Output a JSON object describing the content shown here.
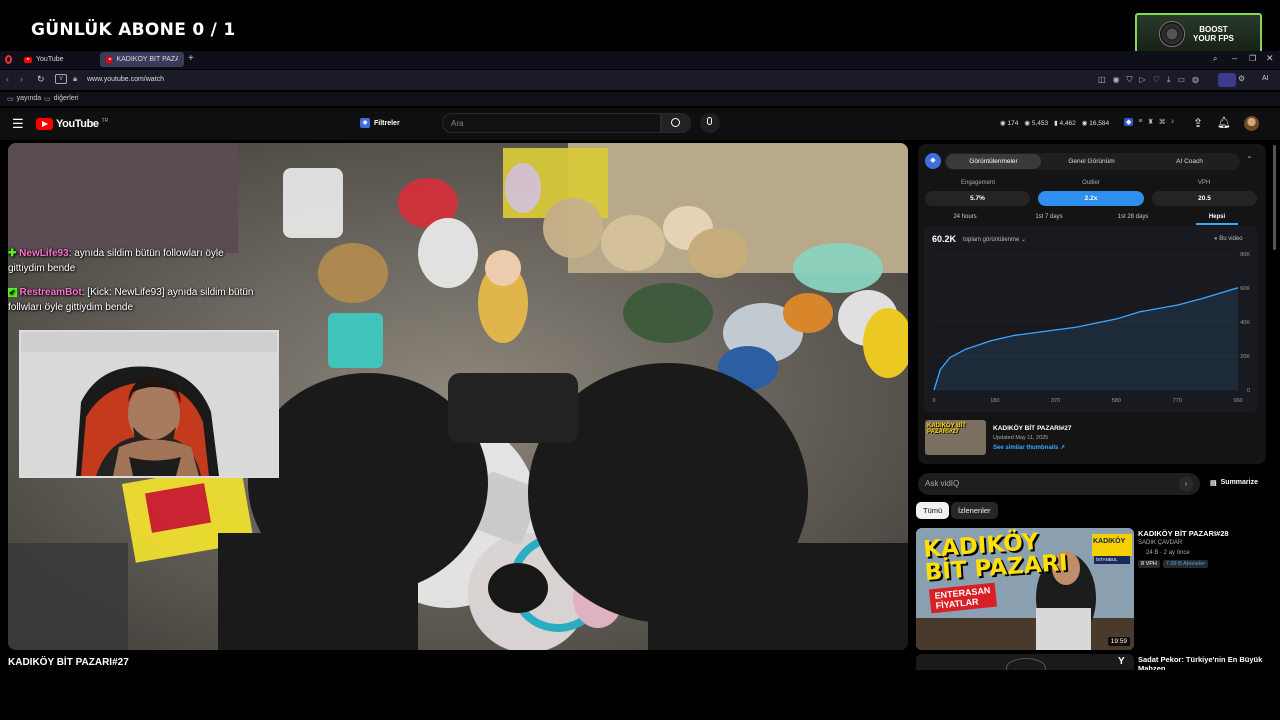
{
  "overlay": {
    "title": "GÜNLÜK ABONE 0 / 1",
    "boost_line1": "BOOST",
    "boost_line2": "YOUR FPS"
  },
  "browser": {
    "tabs": [
      {
        "label": "YouTube"
      },
      {
        "label": "KADIKÖY BİT PAZARI..."
      }
    ],
    "url": "www.youtube.com/watch",
    "bookmarks": [
      "yayında",
      "diğerleri"
    ],
    "ai_label": "AI"
  },
  "youtube": {
    "logo_text": "YouTube",
    "logo_sup": "TR",
    "filters_label": "Filtreler",
    "search_placeholder": "Ara",
    "stats": [
      "174",
      "5,453",
      "4,462",
      "16,584"
    ]
  },
  "chat": [
    {
      "user": "NewLife93",
      "user_color": "#ff6fcf",
      "badge_color": "#53fc18",
      "text": ": aynıda sildim bütün followları öyle gittiydim bende"
    },
    {
      "user": "RestreamBot",
      "user_color": "#ff6fcf",
      "badge_color": "#53fc18",
      "text": ": [Kick: NewLife93] aynıda sildim bütün follwları öyle gittiydim bende"
    }
  ],
  "video": {
    "title": "KADIKÖY BİT PAZARI#27"
  },
  "panel": {
    "tabs": [
      "Görüntülenmeler",
      "Genel Görünüm",
      "AI Coach"
    ],
    "metrics": [
      {
        "label": "Engagement",
        "value": "5.7%"
      },
      {
        "label": "Outlier",
        "value": "2.2x"
      },
      {
        "label": "VPH",
        "value": "20.5"
      }
    ],
    "ranges": [
      "24 hours",
      "1st 7 days",
      "1st 28 days",
      "Hepsi"
    ],
    "total": "60.2K",
    "total_label": "toplam görüntülenme",
    "legend": "Bu video",
    "video_title": "KADIKÖY BİT PAZARI#27",
    "updated": "Updated May 11, 2025",
    "link": "See similar thumbnails ↗"
  },
  "chart_data": {
    "type": "area",
    "title": "",
    "xlabel": "",
    "ylabel": "",
    "series": [
      {
        "name": "Bu video"
      }
    ],
    "x_ticks": [
      "0",
      "180",
      "370",
      "580",
      "770",
      "960"
    ],
    "y_ticks": [
      "0",
      "20K",
      "40K",
      "60K",
      "80K"
    ],
    "xlim": [
      0,
      960
    ],
    "ylim": [
      0,
      80000
    ],
    "x": [
      0,
      20,
      50,
      100,
      180,
      250,
      370,
      450,
      580,
      650,
      770,
      850,
      960
    ],
    "y": [
      0,
      12000,
      19000,
      24000,
      29000,
      32000,
      35000,
      37000,
      42000,
      46000,
      50000,
      54000,
      60200
    ],
    "grid": true,
    "legend_position": "top-right",
    "color": "#3ea6ff"
  },
  "ask": {
    "placeholder": "Ask vidIQ",
    "summarize": "Summarize"
  },
  "chips": [
    "Tümü",
    "İzlenenler"
  ],
  "recommendations": [
    {
      "title": "KADIKÖY BİT PAZARI#28",
      "channel": "SADIK ÇAVDAR",
      "meta": "24 B · 2 ay önce",
      "vph": "8 VPH",
      "subs": "7.09 B Aboneler",
      "duration": "19:59",
      "thumb_line1": "KADIKÖY",
      "thumb_line2": "BİT PAZARI",
      "thumb_line3": "ENTERASAN",
      "thumb_line4": "FİYATLAR",
      "thumb_sign": "KADIKÖY",
      "thumb_sign2": "İSTANBUL"
    },
    {
      "title": "Sadat Pekor: Türkiye'nin En Büyük Mahzen"
    }
  ],
  "icons": [
    "menu-icon",
    "search-icon",
    "mic-icon",
    "upload-icon",
    "bell-icon",
    "summarize-icon",
    "arrow-right-icon"
  ]
}
